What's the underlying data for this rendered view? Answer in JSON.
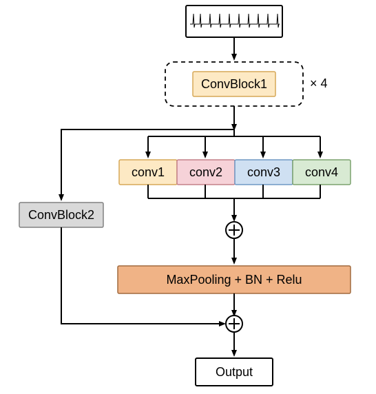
{
  "blocks": {
    "input_signal": "ECG waveform",
    "convblock1": "ConvBlock1",
    "convblock1_multiplier": "× 4",
    "conv1": "conv1",
    "conv2": "conv2",
    "conv3": "conv3",
    "conv4": "conv4",
    "convblock2": "ConvBlock2",
    "pooling": "MaxPooling + BN + Relu",
    "output": "Output"
  },
  "colors": {
    "convblock1_fill": "#fde9c4",
    "convblock1_stroke": "#d6a756",
    "conv1_fill": "#fde9c4",
    "conv1_stroke": "#d6a756",
    "conv2_fill": "#f6d2d8",
    "conv2_stroke": "#c48088",
    "conv3_fill": "#cfe0f2",
    "conv3_stroke": "#6f98c4",
    "conv4_fill": "#d8ead3",
    "conv4_stroke": "#7ba26e",
    "convblock2_fill": "#d9d9d9",
    "convblock2_stroke": "#808080",
    "pooling_fill": "#f0b386",
    "pooling_stroke": "#a06a3e",
    "output_fill": "#ffffff",
    "output_stroke": "#000000",
    "arrow_stroke": "#000000",
    "dashed_stroke": "#000000"
  }
}
